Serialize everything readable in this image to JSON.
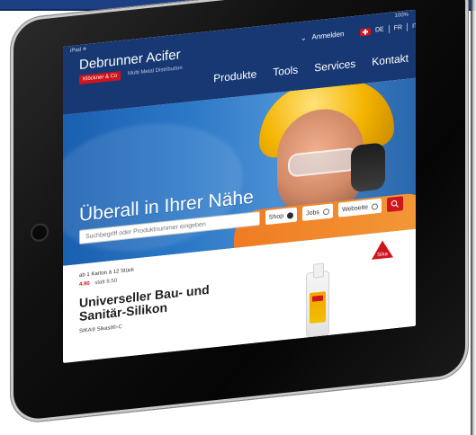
{
  "status": {
    "left": "iPad ✈",
    "right": "100%"
  },
  "header": {
    "brand_name": "Debrunner Acifer",
    "badge": "Klöckner & Co",
    "tagline": "Multi Metal Distribution",
    "login_label": "Anmelden",
    "languages": [
      "DE",
      "FR",
      "IT"
    ]
  },
  "nav": {
    "items": [
      "Produkte",
      "Tools",
      "Services",
      "Kontakt"
    ]
  },
  "hero": {
    "heading": "Überall in Ihrer Nähe"
  },
  "search": {
    "placeholder": "Suchbegriff oder Produktnummer eingeben",
    "options": [
      {
        "label": "Shop",
        "selected": true
      },
      {
        "label": "Jobs",
        "selected": false
      },
      {
        "label": "Webseite",
        "selected": false
      }
    ]
  },
  "product": {
    "pack_info": "ab 1 Karton à 12 Stück",
    "price_sale": "4.90",
    "price_old": "statt 8.50",
    "title_line1": "Universeller Bau- und",
    "title_line2": "Sanitär-Silikon",
    "subtitle": "SIKA® Sikasil®-C",
    "brand_logo_text": "Sika"
  },
  "colors": {
    "header_blue": "#173873",
    "accent_red": "#d0141c",
    "hero_blue": "#2b78c7"
  },
  "icons": {
    "search": "search-icon",
    "chevron": "chevron-down-icon"
  }
}
